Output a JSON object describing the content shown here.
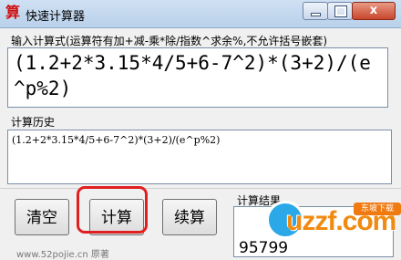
{
  "window": {
    "icon_glyph": "算",
    "title": "快速计算器",
    "close_glyph": "x"
  },
  "expression": {
    "label": "输入计算式(运算符有加+减-乘*除/指数^求余%,不允许括号嵌套)",
    "value": "(1.2+2*3.15*4/5+6-7^2)*(3+2)/(e^p%2)"
  },
  "history": {
    "label": "计算历史",
    "entries": [
      "(1.2+2*3.15*4/5+6-7^2)*(3+2)/(e^p%2)"
    ]
  },
  "buttons": {
    "clear": "清空",
    "calculate": "计算",
    "continue": "续算"
  },
  "result": {
    "label": "计算结果",
    "value": "95799"
  },
  "status": {
    "text": "www.52pojie.cn  原著"
  },
  "watermark": {
    "text": "uzzf.com",
    "badge": "东坡下载"
  },
  "colors": {
    "highlight": "#e02020",
    "watermark_orange": "#f08a10",
    "watermark_blue": "#2aa8e8"
  }
}
